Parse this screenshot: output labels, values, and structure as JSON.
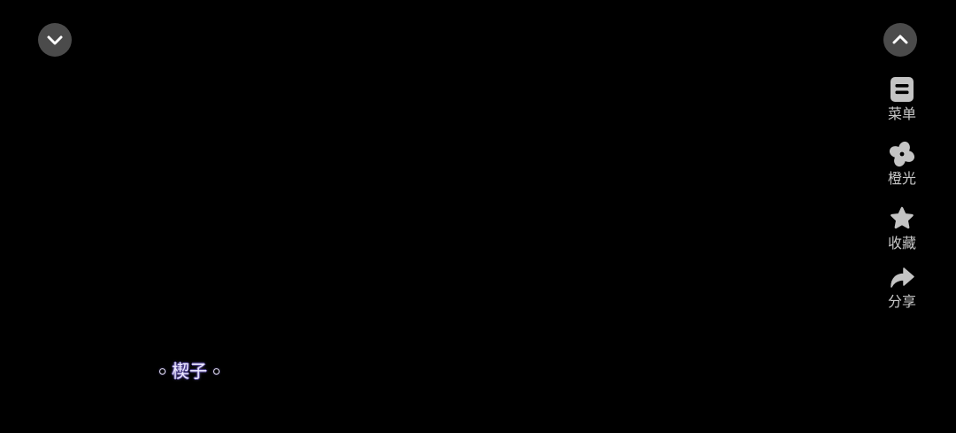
{
  "top_controls": {
    "left_button_icon": "chevron-down-icon",
    "right_button_icon": "chevron-up-icon"
  },
  "side_menu": {
    "items": [
      {
        "label": "菜单",
        "icon": "menu-document-icon"
      },
      {
        "label": "橙光",
        "icon": "orange-light-pinwheel-icon"
      },
      {
        "label": "收藏",
        "icon": "star-icon"
      },
      {
        "label": "分享",
        "icon": "share-arrow-icon"
      }
    ]
  },
  "chapter": {
    "title": "楔子"
  },
  "colors": {
    "background": "#000000",
    "button_bg": "#4b4b4b",
    "icon": "#c4c4c4",
    "label": "#c8c8c8",
    "chapter_text": "#eeeaff",
    "chapter_outline": "#5b4d9e"
  }
}
